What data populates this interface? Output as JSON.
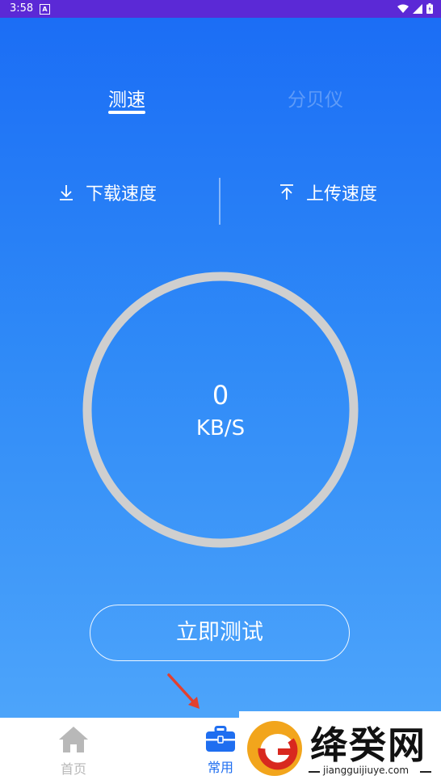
{
  "status_bar": {
    "time": "3:58",
    "notification_badge": "A"
  },
  "tabs": [
    {
      "label": "测速",
      "active": true
    },
    {
      "label": "分贝仪",
      "active": false
    }
  ],
  "modes": {
    "download": {
      "label": "下载速度",
      "icon": "download-arrow-icon"
    },
    "upload": {
      "label": "上传速度",
      "icon": "upload-arrow-icon"
    }
  },
  "gauge": {
    "value": "0",
    "unit": "KB/S"
  },
  "start_button": {
    "label": "立即测试"
  },
  "bottom_nav": [
    {
      "label": "首页",
      "icon": "home-icon",
      "active": false
    },
    {
      "label": "常用",
      "icon": "toolbox-icon",
      "active": true
    }
  ],
  "watermark": {
    "brand": "绛癸网",
    "url": "jiangguijiuye.com"
  },
  "colors": {
    "accent": "#1f6ef0",
    "status_bar": "#5b29d6",
    "annotation_arrow": "#e2402f"
  }
}
